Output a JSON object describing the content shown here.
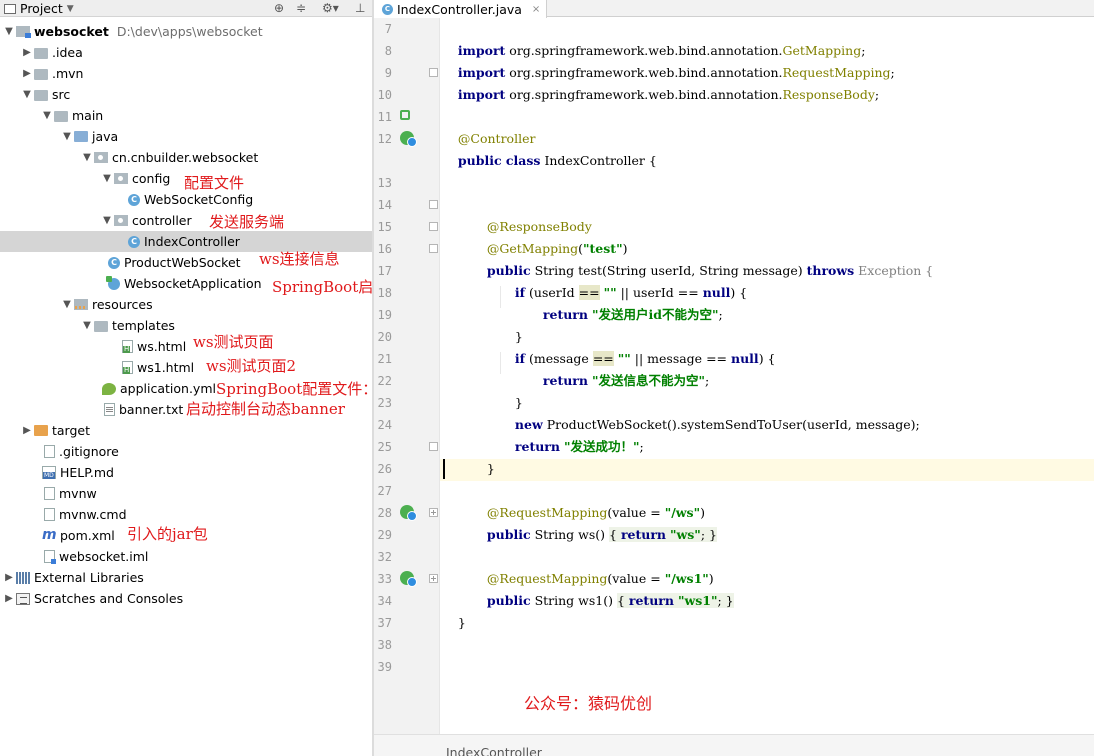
{
  "project_panel": {
    "title": "Project",
    "tree": [
      {
        "label": "websocket",
        "path": "D:\\dev\\apps\\websocket"
      },
      {
        "label": ".idea"
      },
      {
        "label": ".mvn"
      },
      {
        "label": "src"
      },
      {
        "label": "main"
      },
      {
        "label": "java"
      },
      {
        "label": "cn.cnbuilder.websocket"
      },
      {
        "label": "config"
      },
      {
        "label": "WebSocketConfig"
      },
      {
        "label": "controller"
      },
      {
        "label": "IndexController"
      },
      {
        "label": "ProductWebSocket"
      },
      {
        "label": "WebsocketApplication"
      },
      {
        "label": "resources"
      },
      {
        "label": "templates"
      },
      {
        "label": "ws.html"
      },
      {
        "label": "ws1.html"
      },
      {
        "label": "application.yml"
      },
      {
        "label": "banner.txt"
      },
      {
        "label": "target"
      },
      {
        "label": ".gitignore"
      },
      {
        "label": "HELP.md"
      },
      {
        "label": "mvnw"
      },
      {
        "label": "mvnw.cmd"
      },
      {
        "label": "pom.xml"
      },
      {
        "label": "websocket.iml"
      },
      {
        "label": "External Libraries"
      },
      {
        "label": "Scratches and Consoles"
      }
    ]
  },
  "annotations": {
    "config": "配置文件",
    "controller": "发送服务端",
    "product_ws": "ws连接信息",
    "application": "SpringBoot启动类",
    "ws_html": "ws测试页面",
    "ws1_html": "ws测试页面2",
    "yml": "SpringBoot配置文件：端口号...",
    "banner": "启动控制台动态banner",
    "pom": "引入的jar包"
  },
  "editor": {
    "tab_label": "IndexController.java",
    "line_numbers": [
      "7",
      "8",
      "9",
      "10",
      "11",
      "12",
      "13",
      "14",
      "15",
      "16",
      "17",
      "18",
      "19",
      "20",
      "21",
      "22",
      "23",
      "24",
      "25",
      "26",
      "27",
      "28",
      "29",
      "32",
      "33",
      "34",
      "37",
      "38",
      "39"
    ],
    "code": {
      "l7a": "import",
      "l7b": " org.springframework.web.bind.annotation.",
      "l7c": "GetMapping",
      "l7d": ";",
      "l8a": "import",
      "l8b": " org.springframework.web.bind.annotation.",
      "l8c": "RequestMapping",
      "l8d": ";",
      "l9a": "import",
      "l9b": " org.springframework.web.bind.annotation.",
      "l9c": "ResponseBody",
      "l9d": ";",
      "l11": "@Controller",
      "l12a": "public class",
      "l12b": " IndexController {",
      "l15": "@ResponseBody",
      "l16a": "@GetMapping",
      "l16b": "(",
      "l16c": "\"test\"",
      "l16d": ")",
      "l17a": "public",
      "l17b": " String test(String userId, String message) ",
      "l17c": "throws",
      "l17d": " Exception {",
      "l18a": "if",
      "l18b": " (userId ",
      "l18c": "==",
      "l18d": " ",
      "l18e": "\"\"",
      "l18f": " || userId ",
      "l18g": "==",
      "l18h": " ",
      "l18i": "null",
      "l18j": ") {",
      "l19a": "return",
      "l19b": " ",
      "l19c": "\"发送用户id不能为空\"",
      "l19d": ";",
      "l20": "}",
      "l21a": "if",
      "l21b": " (message ",
      "l21c": "==",
      "l21d": " ",
      "l21e": "\"\"",
      "l21f": " || message ",
      "l21g": "==",
      "l21h": " ",
      "l21i": "null",
      "l21j": ") {",
      "l22a": "return",
      "l22b": " ",
      "l22c": "\"发送信息不能为空\"",
      "l22d": ";",
      "l23": "}",
      "l24a": "new",
      "l24b": " ProductWebSocket().systemSendToUser(userId, message);",
      "l25a": "return",
      "l25b": " ",
      "l25c": "\"发送成功！\"",
      "l25d": ";",
      "l26": "}",
      "l28a": "@RequestMapping",
      "l28b": "(value = ",
      "l28c": "\"/ws\"",
      "l28d": ")",
      "l29a": "public",
      "l29b": " String ws() ",
      "l29c": "{ ",
      "l29d": "return",
      "l29e": " ",
      "l29f": "\"ws\"",
      "l29g": "; }",
      "l33a": "@RequestMapping",
      "l33b": "(value = ",
      "l33c": "\"/ws1\"",
      "l33d": ")",
      "l34a": "public",
      "l34b": " String ws1() ",
      "l34c": "{ ",
      "l34d": "return",
      "l34e": " ",
      "l34f": "\"ws1\"",
      "l34g": "; }",
      "l37": "}"
    },
    "breadcrumb": "IndexController"
  },
  "watermark": "公众号：猿码优创",
  "colors": {
    "keyword": "#000080",
    "annotation": "#808000",
    "string": "#008000",
    "note_red": "#e0191b",
    "selection": "#d5d5d5",
    "current_line": "#fffae3"
  }
}
